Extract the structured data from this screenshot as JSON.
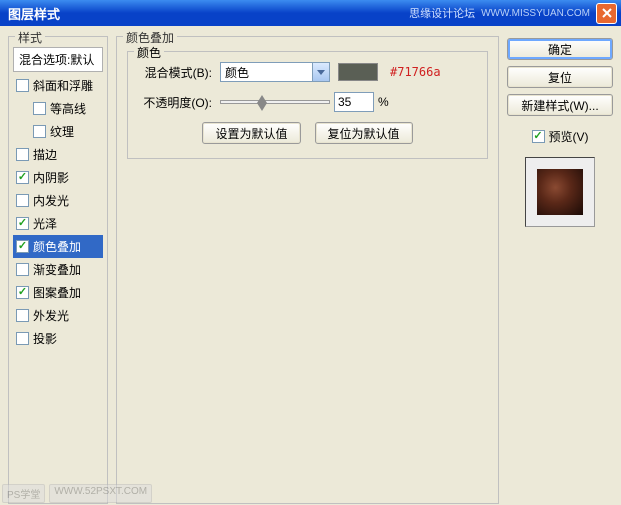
{
  "title": "图层样式",
  "forum": "思缘设计论坛",
  "url": "WWW.MISSYUAN.COM",
  "styles_legend": "样式",
  "styles_header": "混合选项:默认",
  "items": [
    {
      "label": "斜面和浮雕",
      "checked": false,
      "indent": false,
      "selected": false
    },
    {
      "label": "等高线",
      "checked": false,
      "indent": true,
      "selected": false
    },
    {
      "label": "纹理",
      "checked": false,
      "indent": true,
      "selected": false
    },
    {
      "label": "描边",
      "checked": false,
      "indent": false,
      "selected": false
    },
    {
      "label": "内阴影",
      "checked": true,
      "indent": false,
      "selected": false
    },
    {
      "label": "内发光",
      "checked": false,
      "indent": false,
      "selected": false
    },
    {
      "label": "光泽",
      "checked": true,
      "indent": false,
      "selected": false
    },
    {
      "label": "颜色叠加",
      "checked": true,
      "indent": false,
      "selected": true
    },
    {
      "label": "渐变叠加",
      "checked": false,
      "indent": false,
      "selected": false
    },
    {
      "label": "图案叠加",
      "checked": true,
      "indent": false,
      "selected": false
    },
    {
      "label": "外发光",
      "checked": false,
      "indent": false,
      "selected": false
    },
    {
      "label": "投影",
      "checked": false,
      "indent": false,
      "selected": false
    }
  ],
  "main_legend": "颜色叠加",
  "inner_legend": "颜色",
  "blend_label": "混合模式(B):",
  "blend_value": "颜色",
  "swatch_hex": "#71766a",
  "opacity_label": "不透明度(O):",
  "opacity_value": "35",
  "opacity_unit": "%",
  "btn_default": "设置为默认值",
  "btn_reset": "复位为默认值",
  "right": {
    "ok": "确定",
    "cancel": "复位",
    "new_style": "新建样式(W)...",
    "preview": "预览(V)"
  },
  "watermark": {
    "a": "PS学堂",
    "b": "WWW.52PSXT.COM"
  }
}
